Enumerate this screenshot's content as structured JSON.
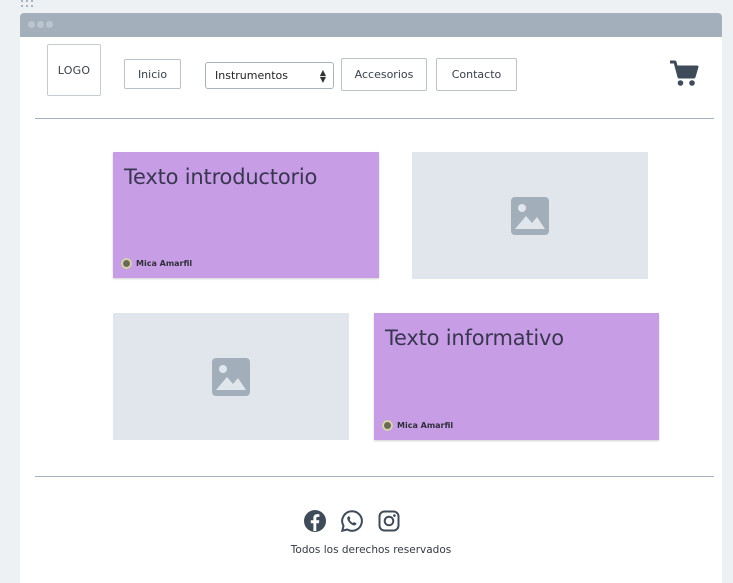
{
  "header": {
    "logo_text": "LOGO",
    "nav": {
      "home_label": "Inicio",
      "instruments_selected": "Instrumentos",
      "accessories_label": "Accesorios",
      "contact_label": "Contacto"
    },
    "cart_icon": "shopping-cart-icon"
  },
  "content": {
    "card_intro": {
      "title": "Texto introductorio",
      "author": "Mica Amarfil"
    },
    "card_info": {
      "title": "Texto informativo",
      "author": "Mica Amarfil"
    },
    "image_icon": "image-placeholder-icon"
  },
  "footer": {
    "social_icons": [
      "facebook-icon",
      "whatsapp-icon",
      "instagram-icon"
    ],
    "rights_text": "Todos los derechos reservados"
  },
  "colors": {
    "card_bg": "#c79de6",
    "placeholder_bg": "#e1e6ec",
    "titlebar": "#a3afba",
    "icon_dark": "#3f4b59"
  }
}
